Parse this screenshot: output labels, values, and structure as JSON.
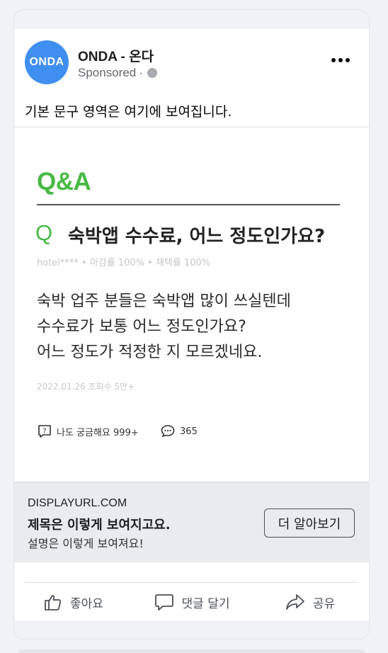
{
  "post": {
    "avatar_text": "ONDA",
    "page_name": "ONDA - 온다",
    "sponsored_label": "Sponsored",
    "primary_text": "기본 문구 영역은 여기에 보여집니다."
  },
  "creative": {
    "title": "Q&A",
    "question_mark": "Q",
    "question": "숙박앱 수수료, 어느 정도인가요?",
    "meta": "hotel**** • 마감률 100% • 채택률 100%",
    "body_lines": [
      "숙박 업주 분들은 숙박앱 많이 쓰실텐데",
      "수수료가 보통 어느 정도인가요?",
      "어느 정도가 적정한 지 모르겠네요."
    ],
    "date": "2022.01.26 조회수 5만+",
    "curious": "나도 궁금해요 999+",
    "comments": "365",
    "accent_color": "#48b946"
  },
  "link": {
    "display_url": "DISPLAYURL.COM",
    "headline": "제목은 이렇게 보여지고요.",
    "description": "설명은 이렇게 보여져요!",
    "cta": "더 알아보기"
  },
  "actions": {
    "like": "좋아요",
    "comment": "댓글 달기",
    "share": "공유"
  }
}
